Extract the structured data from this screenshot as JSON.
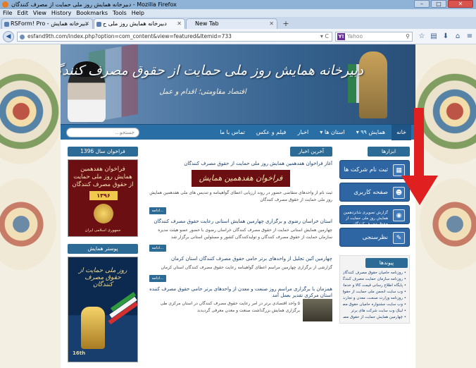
{
  "browser": {
    "window_title": "دبیرخانه همایش روز ملی حمایت از مصرف کنندگان - Mozilla Firefox",
    "window_buttons": [
      "–",
      "□",
      "✕"
    ],
    "menu": [
      "File",
      "Edit",
      "View",
      "History",
      "Bookmarks",
      "Tools",
      "Help"
    ],
    "tabs": [
      {
        "label": "RSForm! Pro - دبیرخانه همایش",
        "active": false
      },
      {
        "label": "دبیرخانه همایش روز ملی ح",
        "active": true
      },
      {
        "label": "New Tab",
        "active": false
      }
    ],
    "new_tab": "+",
    "url": "esfand9th.com/index.php?option=com_content&view=featured&Itemid=733",
    "url_controls": "▾ C",
    "search_engine": "Y!",
    "search_placeholder": "Yahoo",
    "toolbar_icons": [
      "star-icon",
      "clipboard-icon",
      "download-icon",
      "home-icon",
      "menu-icon"
    ]
  },
  "site": {
    "banner": {
      "title": "دبیرخانه همایش روز ملی حمایت از حقوق مصرف کنندگان",
      "subtitle": "اقتصاد مقاومتی؛ اقدام و عمل"
    },
    "nav": {
      "items": [
        "خانه",
        "همایش ۹۹ ▾",
        "استان ها ▾",
        "اخبار",
        "فیلم و عکس",
        "تماس با ما"
      ],
      "search_placeholder": "جستجو..."
    },
    "left": {
      "call_title": "فراخوان سال 1396",
      "poster1": {
        "title": "فراخوان هفدهمین همایش روز ملی حمایت از حقوق مصرف کنندگان",
        "year": "۱۳۹۶",
        "footer": "جمهوری اسلامی ایران"
      },
      "poster_title": "پوستر همایش",
      "poster2": {
        "title": "روز ملی حمایت از حقوق مصرف کنندگان",
        "number": "16th"
      }
    },
    "middle": {
      "latest_title": "آخرین اخبار",
      "news": [
        {
          "title": "آغاز فراخوان هفدهمین همایش روز ملی حمایت از حقوق مصرف کنندگان",
          "banner": "فراخوان هفدهمین همایش",
          "body": "ثبت نام از واحدهای متقاضی حضور در روند ارزیابی اعطای گواهینامه و تندیس های ملی هفدهمین همایش روز ملی حمایت از حقوق مصرف کنندگان",
          "more": "ادامه..."
        },
        {
          "title": "استان خراسان رضوی و برگزاری چهارمین همایش استانی رعایت حقوق مصرف کنندگان",
          "body": "چهارمین همایش استانی حمایت از حقوق مصرف کنندگان خراسان رضوی با حضور عضو هیئت مدیره سازمان حمایت از حقوق مصرف کنندگان و تولیدکنندگان کشور و مسئولین استانی برگزار شد",
          "more": "ادامه..."
        },
        {
          "title": "چهارمین آئین تجلیل از واحدهای برتر حامی حقوق مصرف کنندگان استان کرمان",
          "body": "گزارشی از برگزاری چهارمین مراسم اعطای گواهینامه رعایت حقوق مصرف کنندگان استان کرمان",
          "more": "ادامه..."
        },
        {
          "title": "همزمان با برگزاری مراسم روز صنعت و معدن از واحدهای برتر حامی حقوق مصرف کننده استان مرکزی تقدیر بعمل آمد",
          "body": "۵ واحد اقتصادی برتر در امر رعایت حقوق مصرف کنندگان در استان مرکزی طی برگزاری همایش بزرگداشت صنعت و معدن معرفی گردیدند"
        }
      ]
    },
    "right": {
      "tools_title": "ابزارها",
      "buttons": [
        {
          "label": "ثبت نام شرکت ها",
          "icon": "building-icon"
        },
        {
          "label": "صفحه کاربری",
          "icon": "user-icon"
        },
        {
          "label": "گزارش تصویری شانزدهمین همایش روز ملی حمایت از حقوق مصرف کنندگان",
          "icon": "camera-icon"
        },
        {
          "label": "نظرسنجی",
          "icon": "poll-icon"
        }
      ],
      "links_title": "پیوندها",
      "links": [
        "روزنامه حامیان حقوق مصرف کنندگان",
        "روزنامه سازمان حمایت مصرف کنندگان و تولیدکنندگان",
        "پایگاه اطلاع رسانی قیمت کالا و خدمات",
        "وب سایت انجمن ملی حمایت از حقوق مصرف کنندگان",
        "روزنامه وزارت صنعت، معدن و تجارت",
        "وب سایت جشنواره حامیان حقوق مصرف کنندگان استان فارس",
        "لینک وب سایت شرکت های برتر",
        "چهارمین همایش حمایت از حقوق مصرف"
      ]
    }
  },
  "colors": {
    "nav_blue": "#2a6ea6",
    "box_title": "#2c6b96",
    "annotation_arrow": "#e02020"
  }
}
